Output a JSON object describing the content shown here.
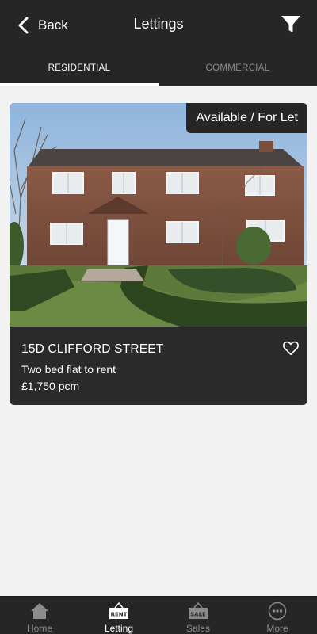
{
  "header": {
    "back_label": "Back",
    "title": "Lettings"
  },
  "tabs": [
    {
      "label": "RESIDENTIAL",
      "active": true
    },
    {
      "label": "COMMERCIAL",
      "active": false
    }
  ],
  "listing": {
    "status_badge": "Available / For Let",
    "address": "15D CLIFFORD STREET",
    "description": "Two bed flat to rent",
    "price": "£1,750 pcm",
    "favourited": false
  },
  "bottom_nav": [
    {
      "label": "Home",
      "icon": "home-icon",
      "active": false
    },
    {
      "label": "Letting",
      "icon": "rent-sign-icon",
      "sign_text": "RENT",
      "active": true
    },
    {
      "label": "Sales",
      "icon": "sale-sign-icon",
      "sign_text": "SALE",
      "active": false
    },
    {
      "label": "More",
      "icon": "more-icon",
      "active": false
    }
  ],
  "colors": {
    "header_bg": "#262626",
    "page_bg": "#f2f2f2",
    "card_bg": "#2a2a2a",
    "active_text": "#ffffff",
    "inactive_text": "#8c8c8c"
  }
}
